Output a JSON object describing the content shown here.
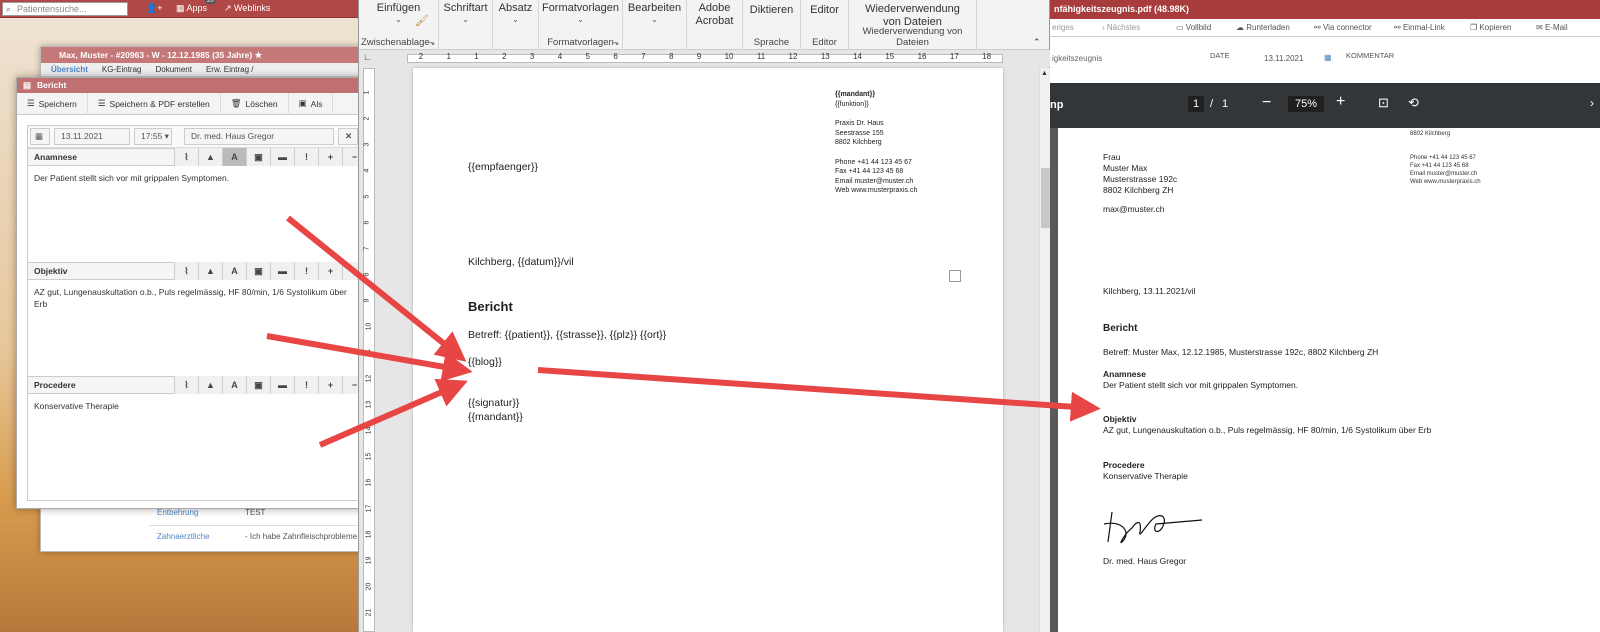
{
  "app": {
    "search_placeholder": "Patientensuche...",
    "apps_label": "Apps",
    "apps_badge": "20",
    "weblinks_label": "Weblinks"
  },
  "patient_window": {
    "title": "Max, Muster - #20963 - W - 12.12.1985 (35 Jahre)",
    "tabs": [
      "Übersicht",
      "KG-Eintrag",
      "Dokument",
      "Erw. Eintrag /"
    ],
    "rows": [
      {
        "key": "Entbehrung",
        "value": "TEST"
      },
      {
        "key": "Zahnaerztliche",
        "value": "- Ich habe Zahnfleischprobleme"
      }
    ]
  },
  "dialog": {
    "title": "Bericht",
    "toolbar": [
      "Speichern",
      "Speichern & PDF erstellen",
      "Löschen",
      "Als"
    ],
    "date": "13.11.2021",
    "time": "17:55",
    "doctor": "Dr. med. Haus Gregor",
    "sections": [
      {
        "label": "Anamnese",
        "text": "Der Patient stellt sich vor mit grippalen Symptomen."
      },
      {
        "label": "Objektiv",
        "text": "AZ gut, Lungenauskultation o.b., Puls regelmässig, HF 80/min, 1/6 Systolikum über Erb"
      },
      {
        "label": "Procedere",
        "text": "Konservative Therapie"
      }
    ]
  },
  "word": {
    "ribbon": [
      {
        "label": "Einfügen",
        "group": "Zwischenablage"
      },
      {
        "label": "Schriftart",
        "group": ""
      },
      {
        "label": "Absatz",
        "group": ""
      },
      {
        "label": "Formatvorlagen",
        "group": "Formatvorlagen"
      },
      {
        "label": "Bearbeiten",
        "group": ""
      },
      {
        "label": "Adobe Acrobat",
        "group": ""
      },
      {
        "label": "Diktieren",
        "group": "Sprache"
      },
      {
        "label": "Editor",
        "group": "Editor"
      },
      {
        "label": "Wiederverwendung von Dateien",
        "group": "Wiederverwendung von Dateien"
      }
    ],
    "ruler_numbers": [
      "2",
      "1",
      "1",
      "2",
      "3",
      "4",
      "5",
      "6",
      "7",
      "8",
      "9",
      "10",
      "11",
      "12",
      "13",
      "14",
      "15",
      "16",
      "17",
      "18"
    ],
    "vruler_numbers": [
      "1",
      "2",
      "3",
      "4",
      "5",
      "6",
      "7",
      "8",
      "9",
      "10",
      "11",
      "12",
      "13",
      "14",
      "15",
      "16",
      "17",
      "18",
      "19",
      "20",
      "21"
    ],
    "doc": {
      "mandant": "{{mandant}}",
      "funktion": "{{funktion}}",
      "praxis": "Praxis Dr. Haus",
      "street": "Seestrasse 155",
      "city": "8802 Kilchberg",
      "phone": "Phone +41 44 123 45 67",
      "fax": "Fax +41 44 123 45 68",
      "email": "Email muster@muster.ch",
      "web": "Web www.musterpraxis.ch",
      "empfaenger": "{{empfaenger}}",
      "place_date": "Kilchberg, {{datum}}/vil",
      "heading": "Bericht",
      "betreff": "Betreff: {{patient}}, {{strasse}}, {{plz}} {{ort}}",
      "blog": "{{blog}}",
      "signatur": "{{signatur}}",
      "mandant2": "{{mandant}}"
    }
  },
  "pdf": {
    "title": "nfähigkeitszeugnis.pdf (48.98K)",
    "actions": [
      "eriges",
      "Nächstes",
      "Vollbild",
      "Runterladen",
      "Via connector",
      "Einmal-Link",
      "Kopieren",
      "E-Mail"
    ],
    "meta_name": "igkeitszeugnis",
    "date_label": "DATE",
    "date_value": "13.11.2021",
    "comment_label": "KOMMENTAR",
    "viewer_name": "np",
    "page_current": "1",
    "page_sep": "/",
    "page_total": "1",
    "zoom": "75%",
    "page": {
      "city_top": "8802 Kilchberg",
      "phone": "Phone +41 44 123 45 67",
      "fax": "Fax +41 44 123 45 68",
      "email": "Email muster@muster.ch",
      "web": "Web www.musterpraxis.ch",
      "addr": [
        "Frau",
        "Muster Max",
        "Musterstrasse 192c",
        "8802 Kilchberg ZH"
      ],
      "recipient_email": "max@muster.ch",
      "place_date": "Kilchberg, 13.11.2021/vil",
      "heading": "Bericht",
      "betreff": "Betreff: Muster Max, 12.12.1985, Musterstrasse 192c, 8802 Kilchberg ZH",
      "sections": [
        {
          "label": "Anamnese",
          "text": "Der Patient stellt sich vor mit grippalen Symptomen."
        },
        {
          "label": "Objektiv",
          "text": "AZ gut, Lungenauskultation o.b., Puls regelmässig, HF 80/min, 1/6 Systolikum über Erb"
        },
        {
          "label": "Procedere",
          "text": "Konservative Therapie"
        }
      ],
      "signer": "Dr. med. Haus Gregor"
    }
  },
  "colors": {
    "arrow": "#e84545",
    "brand": "#b04848",
    "pdf_toolbar": "#323639"
  }
}
